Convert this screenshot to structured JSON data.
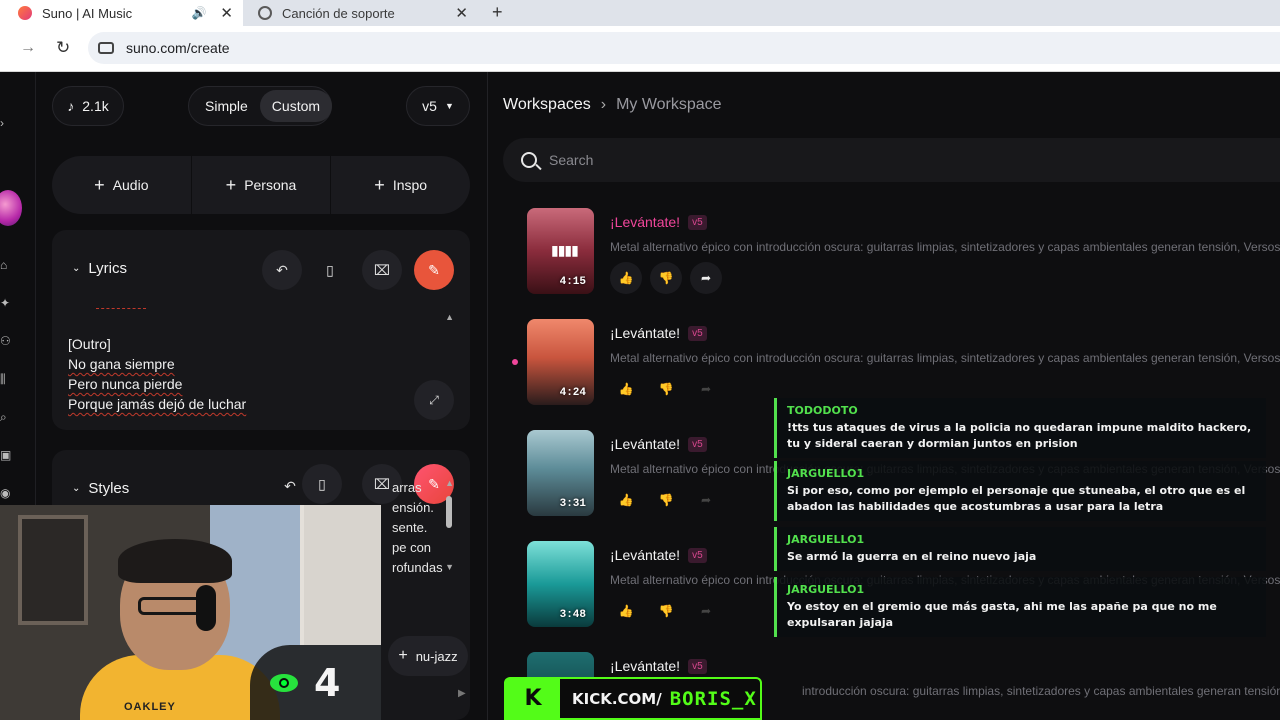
{
  "browser": {
    "tabs": [
      {
        "title": "Suno | AI Music",
        "active": true
      },
      {
        "title": "Canción de soporte",
        "active": false
      }
    ],
    "url": "suno.com/create"
  },
  "create": {
    "credits": "2.1k",
    "modes": [
      "Simple",
      "Custom"
    ],
    "active_mode": "Custom",
    "version": "v5",
    "add_buttons": [
      "Audio",
      "Persona",
      "Inspo"
    ],
    "lyrics": {
      "label": "Lyrics",
      "lines": [
        "[Outro]",
        "No gana siempre",
        "Pero nunca pierde",
        "Porque jamás dejó de luchar"
      ]
    },
    "styles": {
      "label": "Styles",
      "visible_text": [
        "arras",
        "ensión.",
        "sente.",
        "pe con",
        "rofundas"
      ],
      "tag": "nu-jazz"
    }
  },
  "workspace": {
    "breadcrumb_root": "Workspaces",
    "breadcrumb_current": "My Workspace",
    "search_placeholder": "Search",
    "songs": [
      {
        "title": "¡Levántate!",
        "version": "v5",
        "duration": "4:15",
        "description": "Metal alternativo épico con introducción oscura: guitarras limpias, sintetizadores y capas ambientales generan tensión, Versos mode",
        "playing": true
      },
      {
        "title": "¡Levántate!",
        "version": "v5",
        "duration": "4:24",
        "description": "Metal alternativo épico con introducción oscura: guitarras limpias, sintetizadores y capas ambientales generan tensión, Versos mode",
        "playing": false
      },
      {
        "title": "¡Levántate!",
        "version": "v5",
        "duration": "3:31",
        "description": "Metal alternativo épico con introducción oscura: guitarras limpias, sintetizadores y capas ambientales generan tensión, Versos mode",
        "playing": false
      },
      {
        "title": "¡Levántate!",
        "version": "v5",
        "duration": "3:48",
        "description": "Metal alternativo épico con introducción oscura: guitarras limpias, sintetizadores y capas ambientales generan tensión, Versos mode",
        "playing": false
      },
      {
        "title": "¡Levántate!",
        "version": "v5",
        "duration": "",
        "description": "introducción oscura: guitarras limpias, sintetizadores y capas ambientales generan tensión, Versos mode",
        "playing": false
      }
    ]
  },
  "stream": {
    "viewer_count": "4",
    "shirt_text": "OAKLEY",
    "kick_letter": "K",
    "kick_url": "KICK.COM/",
    "kick_name": "BORIS_X",
    "chat": [
      {
        "user": "TODODOTO",
        "text": "!tts tus ataques de virus a la policia no quedaran impune maldito hackero, tu y sideral caeran y dormian juntos en prision"
      },
      {
        "user": "JARGUELLO1",
        "text": "Si por eso, como por ejemplo el personaje que stuneaba, el otro que es el abadon las habilidades que acostumbras a usar para la letra"
      },
      {
        "user": "JARGUELLO1",
        "text": "Se armó la guerra en el reino nuevo jaja"
      },
      {
        "user": "JARGUELLO1",
        "text": "Yo estoy en el gremio que más gasta, ahi me las apañe pa que no me expulsaran jajaja"
      }
    ]
  },
  "colors": {
    "accent": "#e8553b",
    "pink": "#f0469b",
    "kick": "#53fc18"
  }
}
